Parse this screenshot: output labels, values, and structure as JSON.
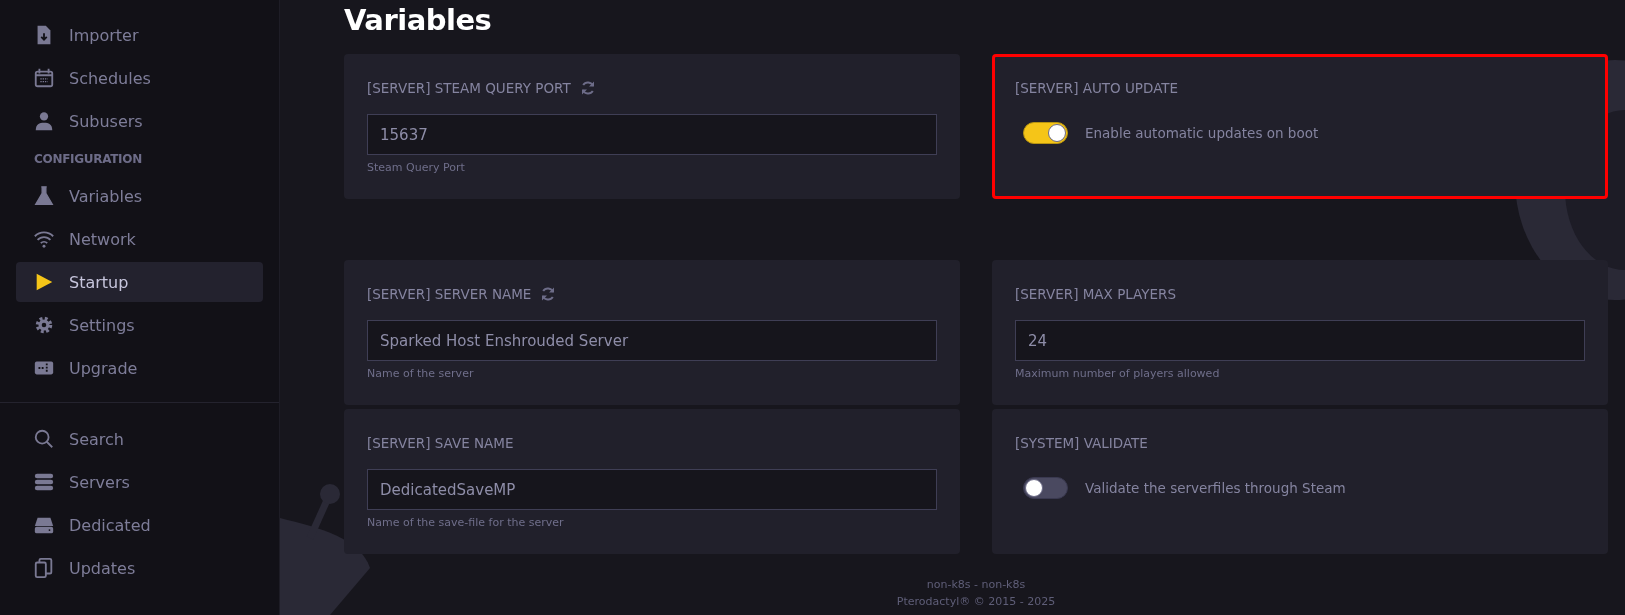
{
  "sidebar": {
    "items": [
      {
        "kind": "link",
        "label": "Importer",
        "selected": false
      },
      {
        "kind": "link",
        "label": "Schedules",
        "selected": false
      },
      {
        "kind": "link",
        "label": "Subusers",
        "selected": false
      },
      {
        "kind": "heading",
        "label": "CONFIGURATION"
      },
      {
        "kind": "link",
        "label": "Variables",
        "selected": false
      },
      {
        "kind": "link",
        "label": "Network",
        "selected": false
      },
      {
        "kind": "link",
        "label": "Startup",
        "selected": true
      },
      {
        "kind": "link",
        "label": "Settings",
        "selected": false
      },
      {
        "kind": "link",
        "label": "Upgrade",
        "selected": false
      },
      {
        "kind": "divider"
      },
      {
        "kind": "link",
        "label": "Search",
        "selected": false
      },
      {
        "kind": "link",
        "label": "Servers",
        "selected": false
      },
      {
        "kind": "link",
        "label": "Dedicated",
        "selected": false
      },
      {
        "kind": "link",
        "label": "Updates",
        "selected": false
      }
    ]
  },
  "page_title": "Variables",
  "variables": [
    {
      "kind": "text",
      "label": "[SERVER] STEAM QUERY PORT",
      "refresh": true,
      "value": "15637",
      "description": "Steam Query Port",
      "highlighted": false
    },
    {
      "kind": "toggle",
      "label": "[SERVER] AUTO UPDATE",
      "on": true,
      "description": "Enable automatic updates on boot",
      "highlighted": true
    },
    {
      "kind": "text",
      "label": "[SERVER] SERVER NAME",
      "refresh": true,
      "value": "Sparked Host Enshrouded Server",
      "description": "Name of the server",
      "highlighted": false
    },
    {
      "kind": "text",
      "label": "[SERVER] MAX PLAYERS",
      "refresh": false,
      "value": "24",
      "description": "Maximum number of players allowed",
      "highlighted": false
    },
    {
      "kind": "text",
      "label": "[SERVER] SAVE NAME",
      "refresh": false,
      "value": "DedicatedSaveMP",
      "description": "Name of the save-file for the server",
      "highlighted": false
    },
    {
      "kind": "toggle",
      "label": "[SYSTEM] VALIDATE",
      "on": false,
      "description": "Validate the serverfiles through Steam",
      "highlighted": false
    }
  ],
  "footer": {
    "line_1": "non-k8s - non-k8s",
    "line_2": "Pterodactyl® © 2015 - 2025"
  }
}
